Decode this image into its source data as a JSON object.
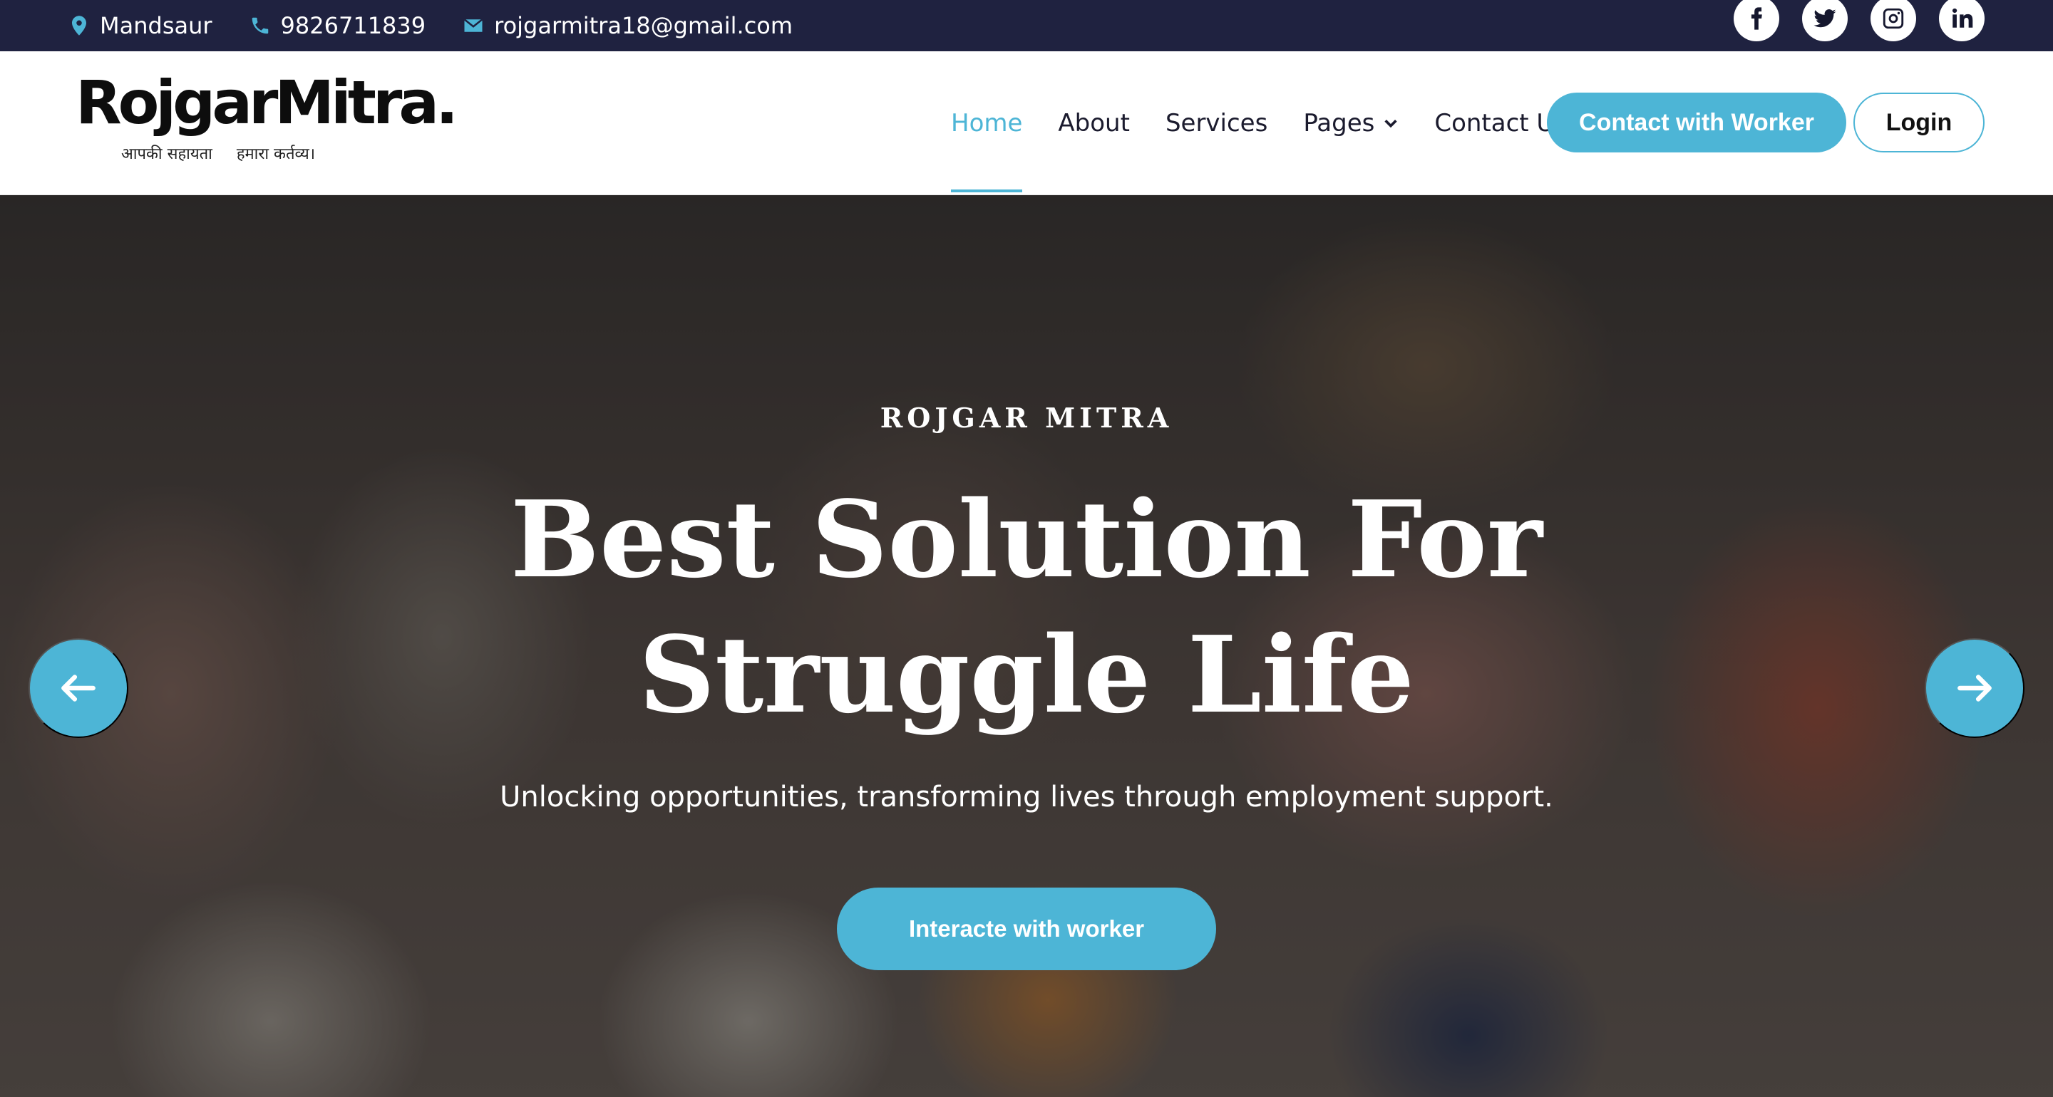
{
  "topbar": {
    "location": "Mandsaur",
    "phone": "9826711839",
    "email": "rojgarmitra18@gmail.com",
    "social_icons": [
      "facebook-icon",
      "twitter-icon",
      "instagram-icon",
      "linkedin-icon"
    ]
  },
  "brand": {
    "logo": "RojgarMitra.",
    "tagline_part1": "आपकी सहायता",
    "tagline_part2": "हमारा कर्तव्य।"
  },
  "nav": {
    "items": [
      {
        "label": "Home",
        "active": true
      },
      {
        "label": "About",
        "active": false
      },
      {
        "label": "Services",
        "active": false
      },
      {
        "label": "Pages",
        "active": false,
        "dropdown": true
      },
      {
        "label": "Contact Us",
        "active": false
      }
    ],
    "contact_button": "Contact with Worker",
    "login_button": "Login"
  },
  "hero": {
    "eyebrow": "ROJGAR MITRA",
    "title": "Best Solution For Struggle Life",
    "subtitle": "Unlocking opportunities, transforming lives through employment support.",
    "cta": "Interacte with worker",
    "prev_icon": "arrow-left-icon",
    "next_icon": "arrow-right-icon"
  },
  "colors": {
    "accent": "#4db5d6",
    "topbar_bg": "#1f2240",
    "text_dark": "#1b1b2e"
  }
}
